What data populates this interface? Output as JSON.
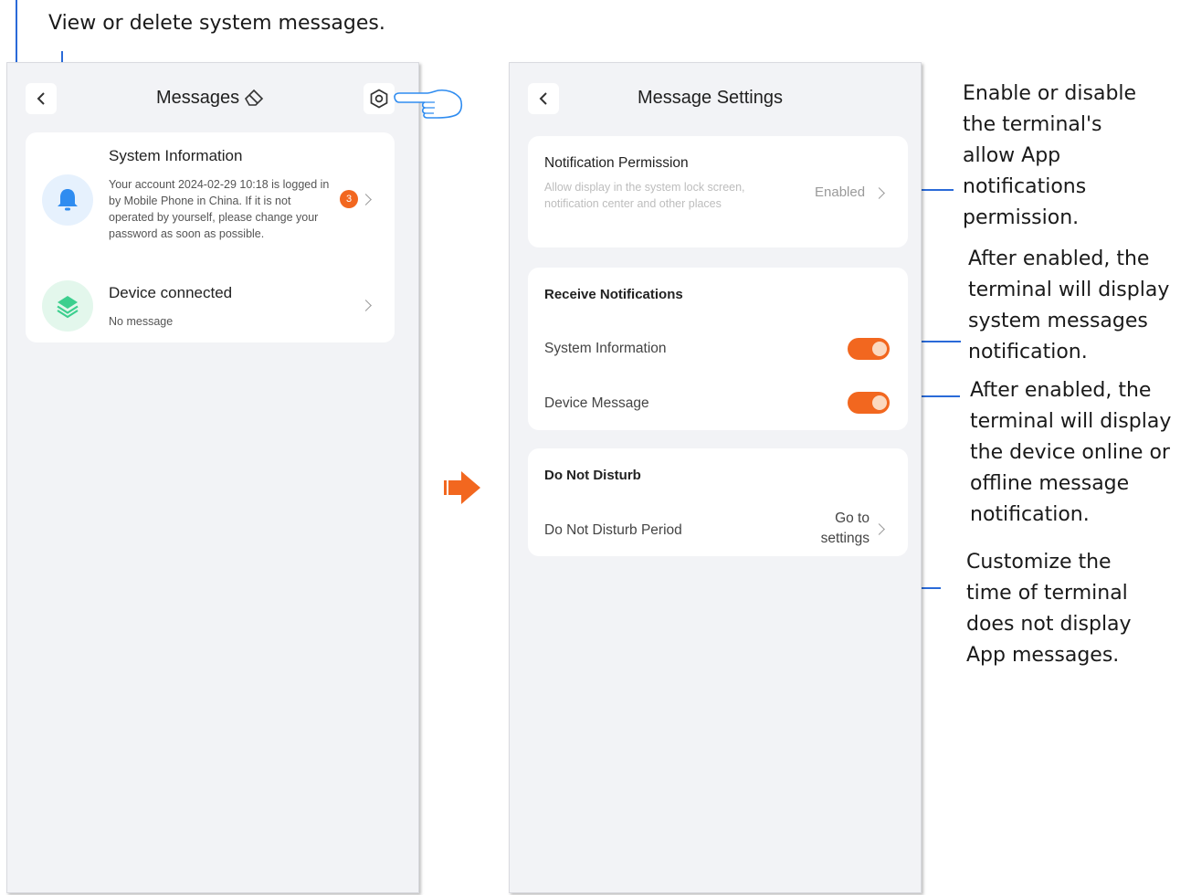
{
  "annotations": {
    "top": "View or delete system messages.",
    "enable_permission": "Enable or disable\nthe terminal's\nallow App\nnotifications\npermission.",
    "system_info": "After enabled, the\nterminal will display\nsystem messages\nnotification.",
    "device_msg": "After enabled, the\nterminal will display\nthe device online or\noffline message\nnotification.",
    "dnd": "Customize the\ntime of terminal\ndoes not display\nApp messages."
  },
  "messages_screen": {
    "title": "Messages",
    "system_info": {
      "title": "System Information",
      "text": "Your account 2024-02-29 10:18 is logged in by Mobile Phone in China. If it is not operated by yourself, please change your password as soon as possible.",
      "badge": "3"
    },
    "device": {
      "title": "Device connected",
      "text": "No message"
    }
  },
  "settings_screen": {
    "title": "Message Settings",
    "permission": {
      "title": "Notification Permission",
      "desc": "Allow display in the system lock screen, notification center and other places",
      "value": "Enabled"
    },
    "receive": {
      "header": "Receive Notifications",
      "system_info": "System Information",
      "device_message": "Device Message"
    },
    "dnd": {
      "header": "Do Not Disturb",
      "period": "Do Not Disturb Period",
      "action": "Go to\nsettings"
    }
  },
  "colors": {
    "accent": "#f2671f",
    "callout_line": "#2a6ad8"
  }
}
